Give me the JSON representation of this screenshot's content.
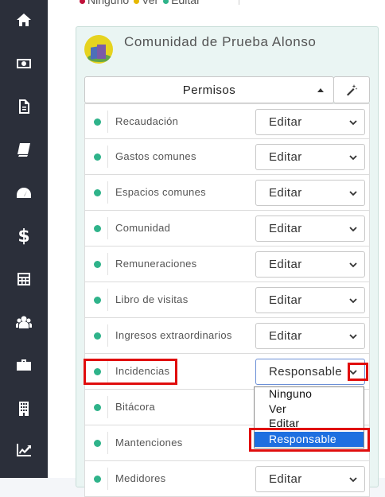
{
  "sidebar": {
    "icons": [
      "home-icon",
      "money-icon",
      "document-icon",
      "book-icon",
      "gauge-icon",
      "dollar-icon",
      "calculator-icon",
      "users-icon",
      "briefcase-icon",
      "building-icon",
      "chart-line-icon"
    ],
    "dollar_glyph": "$"
  },
  "legend": {
    "items": [
      {
        "label": "Ninguno",
        "color": "#c0113a"
      },
      {
        "label": "Ver",
        "color": "#e6b800"
      },
      {
        "label": "Editar",
        "color": "#2fb38a"
      }
    ]
  },
  "community": {
    "title": "Comunidad de Prueba Alonso",
    "permissions_header": "Permisos",
    "wand_icon": "magic-wand-icon"
  },
  "permissions": [
    {
      "name": "Recaudación",
      "value": "Editar"
    },
    {
      "name": "Gastos comunes",
      "value": "Editar"
    },
    {
      "name": "Espacios comunes",
      "value": "Editar"
    },
    {
      "name": "Comunidad",
      "value": "Editar"
    },
    {
      "name": "Remuneraciones",
      "value": "Editar"
    },
    {
      "name": "Libro de visitas",
      "value": "Editar"
    },
    {
      "name": "Ingresos extraordinarios",
      "value": "Editar"
    },
    {
      "name": "Incidencias",
      "value": "Responsable"
    },
    {
      "name": "Bitácora",
      "value": ""
    },
    {
      "name": "Mantenciones",
      "value": ""
    },
    {
      "name": "Medidores",
      "value": "Editar"
    }
  ],
  "dropdown": {
    "options": [
      "Ninguno",
      "Ver",
      "Editar",
      "Responsable"
    ],
    "highlighted": "Responsable"
  },
  "colors": {
    "sidebar_bg": "#2b2f3a",
    "status_green": "#2fb38a",
    "highlight_red": "#e00d0d",
    "option_highlight": "#1e6fe0"
  }
}
